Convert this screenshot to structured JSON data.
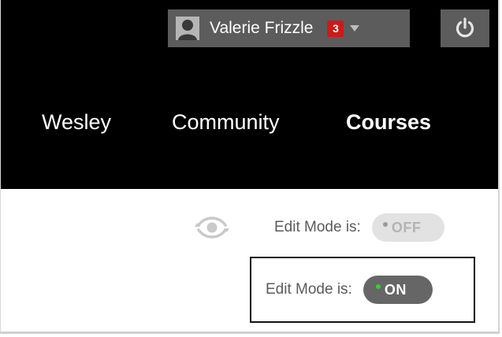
{
  "user_menu": {
    "name": "Valerie Frizzle",
    "notification_count": "3",
    "avatar_icon": "user-silhouette-icon",
    "caret_icon": "caret-down-icon"
  },
  "power": {
    "icon": "power-icon"
  },
  "nav": {
    "items": [
      {
        "label": "Wesley"
      },
      {
        "label": "Community"
      },
      {
        "label": "Courses",
        "active": true
      }
    ]
  },
  "edit_mode": {
    "eye_icon": "eye-toggle-icon",
    "off_row": {
      "label": "Edit Mode is:",
      "state": "OFF"
    },
    "on_row": {
      "label": "Edit Mode is:",
      "state": "ON"
    }
  },
  "colors": {
    "header_bg": "#000000",
    "bar_bg": "#5c5c5c",
    "badge_red": "#cc1a1a",
    "on_dot_green": "#36d02a",
    "toggle_on_bg": "#666666",
    "toggle_off_bg": "#e2e2e2"
  }
}
